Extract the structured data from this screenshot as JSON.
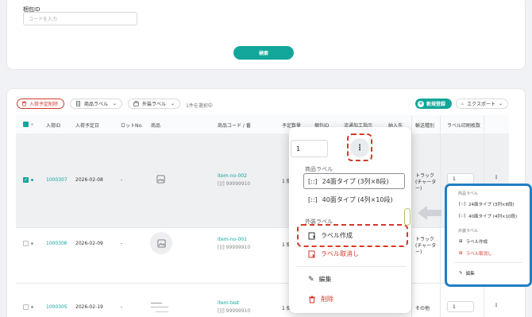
{
  "search": {
    "package_id_label": "梱包ID",
    "package_id_placeholder": "コードを入力",
    "search_button": "検索"
  },
  "toolbar": {
    "delete_button": "入荷予定削除",
    "product_label_button": "商品ラベル",
    "outer_label_button": "外装ラベル",
    "selected_count": "1件を選択中",
    "new_register_button": "新規登録",
    "export_button": "エクスポート"
  },
  "table": {
    "columns": [
      "入荷ID",
      "入荷予定日",
      "ロットNo.",
      "商品",
      "商品コード / 番",
      "予定数量",
      "梱包ID",
      "流通加工指示",
      "納入先",
      "輸送種別",
      "ラベル印刷枚数"
    ],
    "rows": [
      {
        "id": "1000307",
        "date": "2026-02-08",
        "lot": "-",
        "code": "item-no-002",
        "barcode": "99999910",
        "qty": "1 個",
        "transport": "トラック(チャーター)",
        "label_count": "1",
        "checked": true
      },
      {
        "id": "1000306",
        "date": "2026-02-09",
        "lot": "-",
        "code": "item-no-001",
        "barcode": "99999910",
        "qty": "1 個",
        "transport": "トラック(チャーター)",
        "label_count": "",
        "checked": false
      },
      {
        "id": "1000305",
        "date": "2026-02-19",
        "lot": "-",
        "code": "item-test",
        "barcode": "99999910",
        "qty": "1 個",
        "transport": "その他",
        "label_count": "1",
        "checked": false
      }
    ]
  },
  "popup": {
    "input_value": "1",
    "product_section": "商品ラベル",
    "option_24": "24面タイプ (3列×8段)",
    "option_40": "40面タイプ (4列×10段)",
    "outer_section": "外装ラベル",
    "create_label": "ラベル作成",
    "cancel_label": "ラベル取消し",
    "edit": "編集",
    "delete": "削除"
  },
  "mini_menu": {
    "product_section": "商品ラベル",
    "option_24": "24面タイプ (3列×8段)",
    "option_40": "40面タイプ (4列×10段)",
    "outer_section": "外装ラベル",
    "create_label": "ラベル作成",
    "cancel_label": "ラベル取消し",
    "edit": "編集"
  },
  "colors": {
    "accent": "#12a79a",
    "danger": "#d23a2b",
    "highlight_border": "#1f7fc4"
  }
}
